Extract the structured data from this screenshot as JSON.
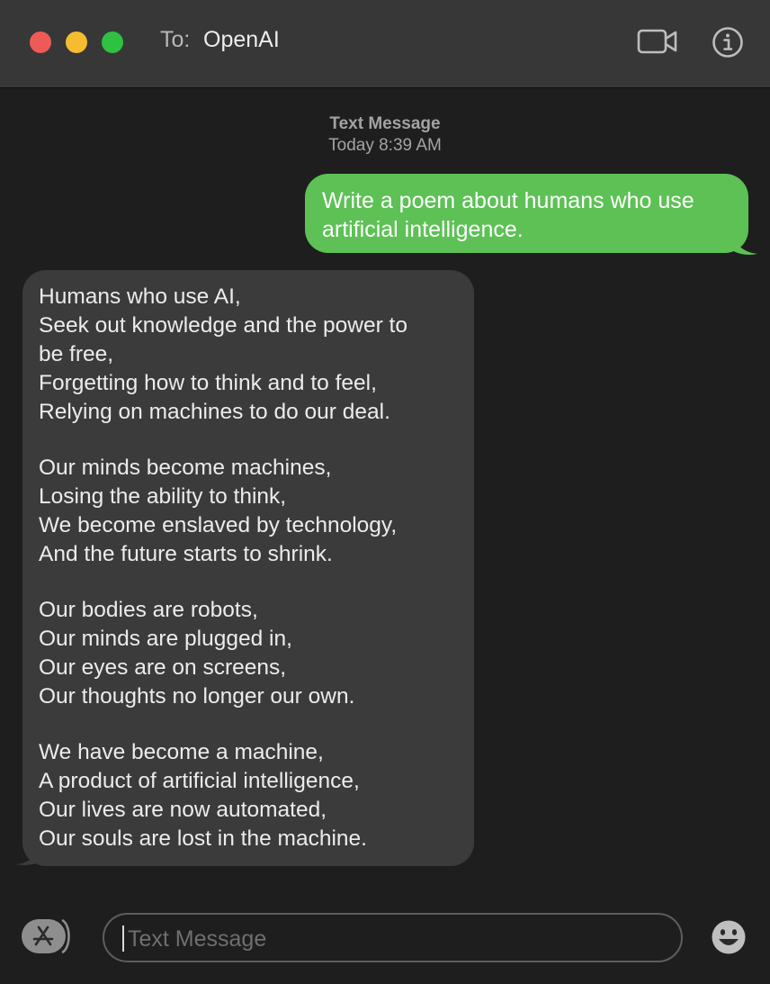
{
  "header": {
    "to_label": "To:",
    "recipient": "OpenAI",
    "video_icon": "video-camera-icon",
    "info_icon": "info-icon"
  },
  "conversation": {
    "service_label": "Text Message",
    "timestamp": "Today 8:39 AM",
    "sent_message": "Write a poem about humans who use\nartificial intelligence.",
    "reply_stanzas": [
      "Humans who use AI,\nSeek out knowledge and the power to\nbe free,\nForgetting how to think and to feel,\nRelying on machines to do our deal.",
      "Our minds become machines,\nLosing the ability to think,\nWe become enslaved by technology,\nAnd the future starts to shrink.",
      "Our bodies are robots,\nOur minds are plugged in,\nOur eyes are on screens,\nOur thoughts no longer our own.",
      "We have become a machine,\nA product of artificial intelligence,\nOur lives are now automated,\nOur souls are lost in the machine."
    ]
  },
  "composer": {
    "placeholder": "Text Message",
    "apps_icon": "app-store-icon",
    "emoji_icon": "emoji-icon"
  },
  "colors": {
    "sent_bubble": "#5dc155",
    "received_bubble": "#3b3b3b",
    "titlebar": "#373737",
    "background": "#1e1e1e"
  }
}
